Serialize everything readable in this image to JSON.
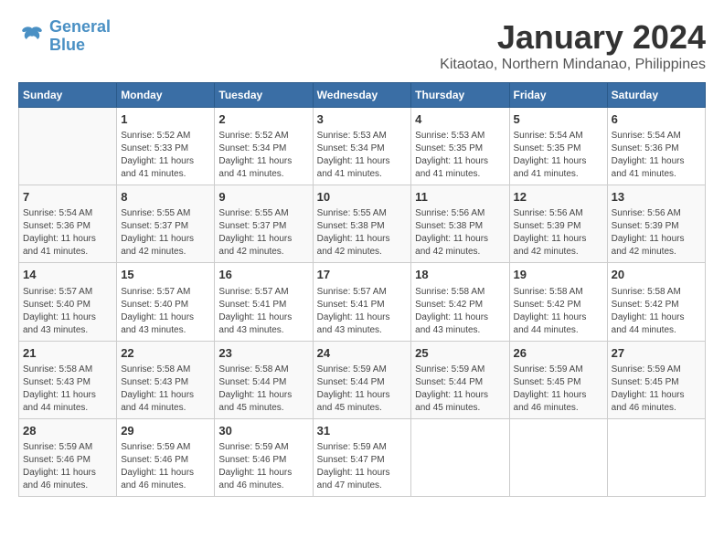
{
  "logo": {
    "line1": "General",
    "line2": "Blue"
  },
  "title": "January 2024",
  "subtitle": "Kitaotao, Northern Mindanao, Philippines",
  "weekdays": [
    "Sunday",
    "Monday",
    "Tuesday",
    "Wednesday",
    "Thursday",
    "Friday",
    "Saturday"
  ],
  "weeks": [
    [
      {
        "day": "",
        "info": ""
      },
      {
        "day": "1",
        "info": "Sunrise: 5:52 AM\nSunset: 5:33 PM\nDaylight: 11 hours\nand 41 minutes."
      },
      {
        "day": "2",
        "info": "Sunrise: 5:52 AM\nSunset: 5:34 PM\nDaylight: 11 hours\nand 41 minutes."
      },
      {
        "day": "3",
        "info": "Sunrise: 5:53 AM\nSunset: 5:34 PM\nDaylight: 11 hours\nand 41 minutes."
      },
      {
        "day": "4",
        "info": "Sunrise: 5:53 AM\nSunset: 5:35 PM\nDaylight: 11 hours\nand 41 minutes."
      },
      {
        "day": "5",
        "info": "Sunrise: 5:54 AM\nSunset: 5:35 PM\nDaylight: 11 hours\nand 41 minutes."
      },
      {
        "day": "6",
        "info": "Sunrise: 5:54 AM\nSunset: 5:36 PM\nDaylight: 11 hours\nand 41 minutes."
      }
    ],
    [
      {
        "day": "7",
        "info": "Sunrise: 5:54 AM\nSunset: 5:36 PM\nDaylight: 11 hours\nand 41 minutes."
      },
      {
        "day": "8",
        "info": "Sunrise: 5:55 AM\nSunset: 5:37 PM\nDaylight: 11 hours\nand 42 minutes."
      },
      {
        "day": "9",
        "info": "Sunrise: 5:55 AM\nSunset: 5:37 PM\nDaylight: 11 hours\nand 42 minutes."
      },
      {
        "day": "10",
        "info": "Sunrise: 5:55 AM\nSunset: 5:38 PM\nDaylight: 11 hours\nand 42 minutes."
      },
      {
        "day": "11",
        "info": "Sunrise: 5:56 AM\nSunset: 5:38 PM\nDaylight: 11 hours\nand 42 minutes."
      },
      {
        "day": "12",
        "info": "Sunrise: 5:56 AM\nSunset: 5:39 PM\nDaylight: 11 hours\nand 42 minutes."
      },
      {
        "day": "13",
        "info": "Sunrise: 5:56 AM\nSunset: 5:39 PM\nDaylight: 11 hours\nand 42 minutes."
      }
    ],
    [
      {
        "day": "14",
        "info": "Sunrise: 5:57 AM\nSunset: 5:40 PM\nDaylight: 11 hours\nand 43 minutes."
      },
      {
        "day": "15",
        "info": "Sunrise: 5:57 AM\nSunset: 5:40 PM\nDaylight: 11 hours\nand 43 minutes."
      },
      {
        "day": "16",
        "info": "Sunrise: 5:57 AM\nSunset: 5:41 PM\nDaylight: 11 hours\nand 43 minutes."
      },
      {
        "day": "17",
        "info": "Sunrise: 5:57 AM\nSunset: 5:41 PM\nDaylight: 11 hours\nand 43 minutes."
      },
      {
        "day": "18",
        "info": "Sunrise: 5:58 AM\nSunset: 5:42 PM\nDaylight: 11 hours\nand 43 minutes."
      },
      {
        "day": "19",
        "info": "Sunrise: 5:58 AM\nSunset: 5:42 PM\nDaylight: 11 hours\nand 44 minutes."
      },
      {
        "day": "20",
        "info": "Sunrise: 5:58 AM\nSunset: 5:42 PM\nDaylight: 11 hours\nand 44 minutes."
      }
    ],
    [
      {
        "day": "21",
        "info": "Sunrise: 5:58 AM\nSunset: 5:43 PM\nDaylight: 11 hours\nand 44 minutes."
      },
      {
        "day": "22",
        "info": "Sunrise: 5:58 AM\nSunset: 5:43 PM\nDaylight: 11 hours\nand 44 minutes."
      },
      {
        "day": "23",
        "info": "Sunrise: 5:58 AM\nSunset: 5:44 PM\nDaylight: 11 hours\nand 45 minutes."
      },
      {
        "day": "24",
        "info": "Sunrise: 5:59 AM\nSunset: 5:44 PM\nDaylight: 11 hours\nand 45 minutes."
      },
      {
        "day": "25",
        "info": "Sunrise: 5:59 AM\nSunset: 5:44 PM\nDaylight: 11 hours\nand 45 minutes."
      },
      {
        "day": "26",
        "info": "Sunrise: 5:59 AM\nSunset: 5:45 PM\nDaylight: 11 hours\nand 46 minutes."
      },
      {
        "day": "27",
        "info": "Sunrise: 5:59 AM\nSunset: 5:45 PM\nDaylight: 11 hours\nand 46 minutes."
      }
    ],
    [
      {
        "day": "28",
        "info": "Sunrise: 5:59 AM\nSunset: 5:46 PM\nDaylight: 11 hours\nand 46 minutes."
      },
      {
        "day": "29",
        "info": "Sunrise: 5:59 AM\nSunset: 5:46 PM\nDaylight: 11 hours\nand 46 minutes."
      },
      {
        "day": "30",
        "info": "Sunrise: 5:59 AM\nSunset: 5:46 PM\nDaylight: 11 hours\nand 46 minutes."
      },
      {
        "day": "31",
        "info": "Sunrise: 5:59 AM\nSunset: 5:47 PM\nDaylight: 11 hours\nand 47 minutes."
      },
      {
        "day": "",
        "info": ""
      },
      {
        "day": "",
        "info": ""
      },
      {
        "day": "",
        "info": ""
      }
    ]
  ]
}
